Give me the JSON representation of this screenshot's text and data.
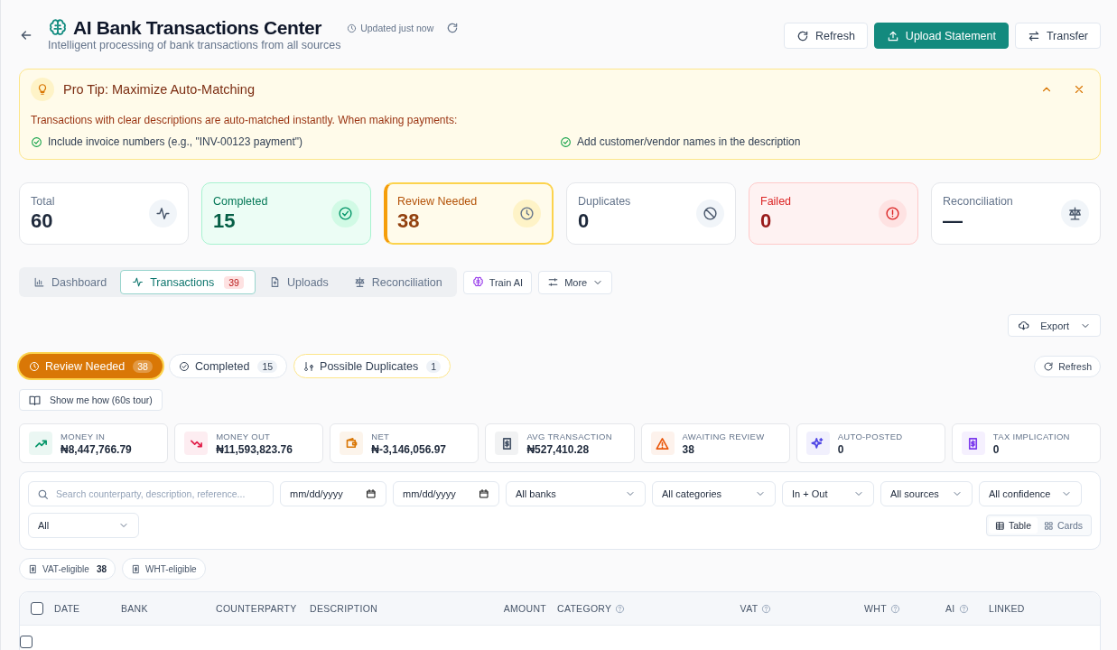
{
  "header": {
    "title": "AI Bank Transactions Center",
    "subtitle": "Intelligent processing of bank transactions from all sources",
    "updated": "Updated just now",
    "actions": [
      {
        "label": "Refresh",
        "kind": "outline"
      },
      {
        "label": "Upload Statement",
        "kind": "primary"
      },
      {
        "label": "Transfer",
        "kind": "outline"
      }
    ]
  },
  "tip": {
    "title": "Pro Tip: Maximize Auto-Matching",
    "text": "Transactions with clear descriptions are auto-matched instantly. When making payments:",
    "expanded": true,
    "bullets": [
      "Include invoice numbers (e.g., \"INV-00123 payment\")",
      "Add customer/vendor names in the description"
    ]
  },
  "stats": [
    {
      "label": "Total",
      "value": "60",
      "kind": "neutral",
      "selected": false
    },
    {
      "label": "Completed",
      "value": "15",
      "kind": "success",
      "selected": false
    },
    {
      "label": "Review Needed",
      "value": "38",
      "kind": "warning",
      "selected": true
    },
    {
      "label": "Duplicates",
      "value": "0",
      "kind": "neutral",
      "selected": false
    },
    {
      "label": "Failed",
      "value": "0",
      "kind": "danger",
      "selected": false
    },
    {
      "label": "Reconciliation",
      "value": "—",
      "kind": "neutral",
      "selected": false
    }
  ],
  "tabs": [
    {
      "label": "Dashboard",
      "selected": false
    },
    {
      "label": "Transactions",
      "badge": "39",
      "selected": true
    },
    {
      "label": "Uploads",
      "selected": false
    },
    {
      "label": "Reconciliation",
      "selected": false
    }
  ],
  "tab_actions": [
    "Train AI",
    "More"
  ],
  "export": "Export",
  "queues": [
    {
      "label": "Review Needed",
      "count": "38",
      "kind": "warning",
      "selected": true
    },
    {
      "label": "Completed",
      "count": "15",
      "kind": "neutral",
      "selected": false
    },
    {
      "label": "Possible Duplicates",
      "count": "1",
      "kind": "duplicate",
      "selected": false
    }
  ],
  "refresh": "Refresh",
  "tour": "Show me how (60s tour)",
  "metrics": [
    {
      "label": "MONEY IN",
      "value": "₦8,447,766.79",
      "color": "#059669"
    },
    {
      "label": "MONEY OUT",
      "value": "₦11,593,823.76",
      "color": "#e11d48"
    },
    {
      "label": "NET",
      "value": "₦-3,146,056.97",
      "color": "#d97706"
    },
    {
      "label": "AVG TRANSACTION",
      "value": "₦527,410.28",
      "color": "#475569"
    },
    {
      "label": "AWAITING REVIEW",
      "value": "38",
      "color": "#ea580c"
    },
    {
      "label": "AUTO-POSTED",
      "value": "0",
      "color": "#4f46e5"
    },
    {
      "label": "TAX IMPLICATION",
      "value": "0",
      "color": "#7c3aed"
    }
  ],
  "filters": {
    "search": {
      "placeholder": "Search counterparty, description, reference..."
    },
    "dates": [
      "mm/dd/yyyy",
      "mm/dd/yyyy"
    ],
    "selects": [
      "All banks",
      "All categories",
      "In + Out",
      "All sources",
      "All confidence",
      "All"
    ],
    "views": [
      {
        "label": "Table",
        "selected": true
      },
      {
        "label": "Cards",
        "selected": false
      }
    ]
  },
  "tax_chips": [
    {
      "label": "VAT-eligible",
      "count": "38"
    },
    {
      "label": "WHT-eligible"
    }
  ],
  "table": {
    "select_all": false,
    "rows": [
      {
        "selected": false
      }
    ],
    "columns": [
      {
        "label": "DATE",
        "help": false
      },
      {
        "label": "BANK",
        "help": false
      },
      {
        "label": "COUNTERPARTY",
        "help": false
      },
      {
        "label": "DESCRIPTION",
        "help": false
      },
      {
        "label": "AMOUNT",
        "help": false
      },
      {
        "label": "CATEGORY",
        "help": true
      },
      {
        "label": "VAT",
        "help": true
      },
      {
        "label": "WHT",
        "help": true
      },
      {
        "label": "AI",
        "help": true
      },
      {
        "label": "LINKED",
        "help": false
      }
    ]
  }
}
